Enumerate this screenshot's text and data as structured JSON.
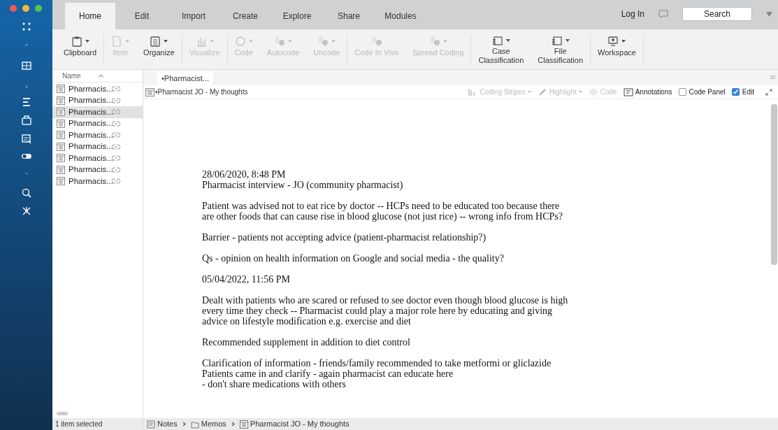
{
  "tabs": [
    {
      "label": "Home",
      "selected": true
    },
    {
      "label": "Edit",
      "selected": false
    },
    {
      "label": "Import",
      "selected": false
    },
    {
      "label": "Create",
      "selected": false
    },
    {
      "label": "Explore",
      "selected": false
    },
    {
      "label": "Share",
      "selected": false
    },
    {
      "label": "Modules",
      "selected": false
    }
  ],
  "top_right": {
    "login": "Log In",
    "search": {
      "placeholder": "Search"
    }
  },
  "ribbon": [
    {
      "label": "Clipboard",
      "disabled": false,
      "caret": true,
      "group_end": true
    },
    {
      "label": "Item",
      "disabled": true,
      "caret": true,
      "group_end": false
    },
    {
      "label": "Organize",
      "disabled": false,
      "caret": true,
      "group_end": true
    },
    {
      "label": "Visualize",
      "disabled": true,
      "caret": true,
      "group_end": true
    },
    {
      "label": "Code",
      "disabled": true,
      "caret": true,
      "group_end": false
    },
    {
      "label": "Autocode",
      "disabled": true,
      "caret": true,
      "group_end": false
    },
    {
      "label": "Uncode",
      "disabled": true,
      "caret": true,
      "group_end": true
    },
    {
      "label": "Code In Vivo",
      "disabled": true,
      "caret": false,
      "group_end": false
    },
    {
      "label": "Spread Coding",
      "disabled": true,
      "caret": true,
      "group_end": true
    },
    {
      "label": "Case Classification",
      "disabled": false,
      "caret": true,
      "group_end": false
    },
    {
      "label": "File Classification",
      "disabled": false,
      "caret": true,
      "group_end": true
    },
    {
      "label": "Workspace",
      "disabled": false,
      "caret": true,
      "group_end": true
    }
  ],
  "list": {
    "column": "Name",
    "items": [
      {
        "label": "Pharmacis...",
        "selected": false
      },
      {
        "label": "Pharmacis...",
        "selected": false
      },
      {
        "label": "Pharmacis...",
        "selected": true
      },
      {
        "label": "Pharmacis...",
        "selected": false
      },
      {
        "label": "Pharmacis...",
        "selected": false
      },
      {
        "label": "Pharmacis...",
        "selected": false
      },
      {
        "label": "Pharmacis...",
        "selected": false
      },
      {
        "label": "Pharmacis...",
        "selected": false
      },
      {
        "label": "Pharmacis...",
        "selected": false
      }
    ]
  },
  "document": {
    "tab": "•Pharmacist...",
    "title": "•Pharmacist JO - My thoughts",
    "toolbar": [
      {
        "kind": "button",
        "label": "Coding Stripes",
        "disabled": true,
        "caret": true
      },
      {
        "kind": "button",
        "label": "Highlight",
        "disabled": true,
        "caret": true
      },
      {
        "kind": "button",
        "label": "Code",
        "disabled": true,
        "caret": false
      },
      {
        "kind": "button",
        "label": "Annotations",
        "disabled": false,
        "caret": false
      },
      {
        "kind": "checkbox",
        "label": "Code Panel",
        "checked": false
      },
      {
        "kind": "checkbox",
        "label": "Edit",
        "checked": true
      }
    ],
    "paragraphs": [
      [
        "28/06/2020, 8:48 PM",
        "Pharmacist interview - JO (community pharmacist)"
      ],
      [
        "Patient was advised not to eat rice by doctor -- HCPs need to be educated too because there",
        "are other foods that can cause rise in blood glucose (not just rice) -- wrong info from HCPs?"
      ],
      [
        "Barrier - patients not accepting advice (patient-pharmacist relationship?)"
      ],
      [
        "Qs - opinion on health information on Google and social media - the quality?"
      ],
      [
        "05/04/2022, 11:56 PM"
      ],
      [
        "Dealt with patients who are scared or refused to see doctor even though blood glucose is high",
        "every time they check -- Pharmacist could play a major role here by educating and giving",
        "advice on lifestyle modification e.g. exercise and diet"
      ],
      [
        "Recommended supplement in addition to diet control"
      ],
      [
        "Clarification of information - friends/family recommended to take metformi or gliclazide",
        "Patients came in and clarify - again pharmacist can educate here",
        "- don't share medications with others"
      ]
    ]
  },
  "status_bar": {
    "selection": "1 item selected",
    "breadcrumb": [
      {
        "label": "Notes"
      },
      {
        "label": "Memos"
      },
      {
        "label": "Pharmacist JO - My thoughts"
      }
    ]
  }
}
